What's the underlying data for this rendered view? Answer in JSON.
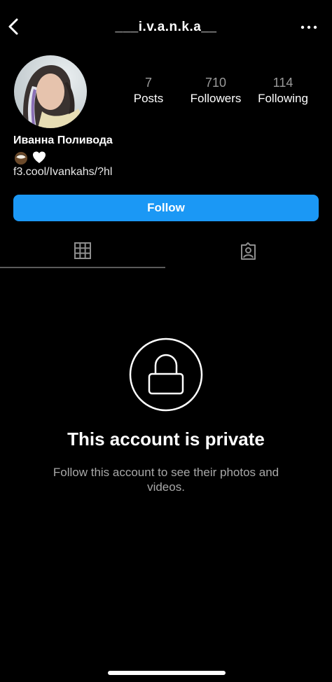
{
  "header": {
    "username": "___i.v.a.n.k.a__",
    "back_icon": "chevron-left-icon",
    "more_icon": "more-horizontal-icon"
  },
  "profile": {
    "avatar_icon": "profile-photo",
    "stats": [
      {
        "value": "7",
        "label": "Posts"
      },
      {
        "value": "710",
        "label": "Followers"
      },
      {
        "value": "114",
        "label": "Following"
      }
    ],
    "full_name": "Иванна Поливода",
    "bio_emojis": "🥥🤍",
    "link": "f3.cool/Ivankahs/?hl"
  },
  "actions": {
    "follow_label": "Follow",
    "follow_color": "#1b98f5"
  },
  "tabs": [
    {
      "icon": "grid-icon",
      "active": true
    },
    {
      "icon": "tagged-person-icon",
      "active": false
    }
  ],
  "private": {
    "icon": "lock-icon",
    "title": "This account is private",
    "subtitle": "Follow this account to see their photos and videos."
  }
}
